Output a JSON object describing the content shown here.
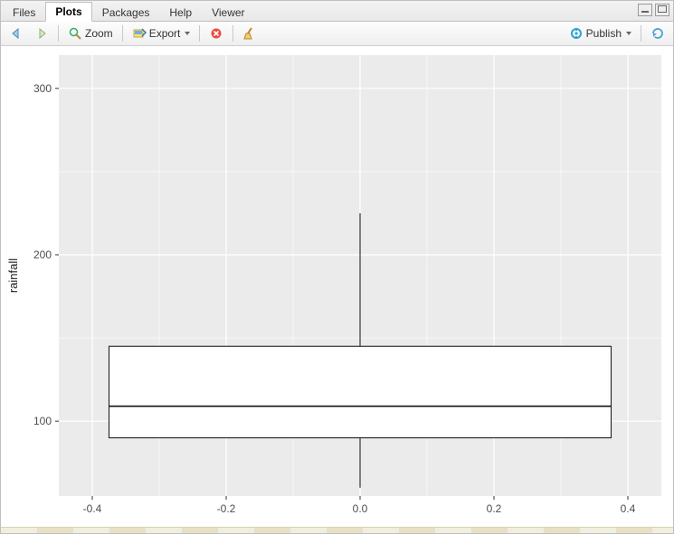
{
  "tabs": {
    "files": "Files",
    "plots": "Plots",
    "packages": "Packages",
    "help": "Help",
    "viewer": "Viewer",
    "active": "plots"
  },
  "toolbar": {
    "zoom_label": "Zoom",
    "export_label": "Export",
    "publish_label": "Publish"
  },
  "chart_data": {
    "type": "boxplot",
    "ylabel": "rainfall",
    "xlabel": "",
    "x_ticks": [
      -0.4,
      -0.2,
      0.0,
      0.2,
      0.4
    ],
    "y_ticks": [
      100,
      200,
      300
    ],
    "xlim": [
      -0.45,
      0.45
    ],
    "ylim": [
      55,
      320
    ],
    "series": [
      {
        "x": 0.0,
        "min": 60,
        "q1": 90,
        "median": 109,
        "q3": 145,
        "max": 225,
        "box_halfwidth": 0.375
      }
    ]
  }
}
